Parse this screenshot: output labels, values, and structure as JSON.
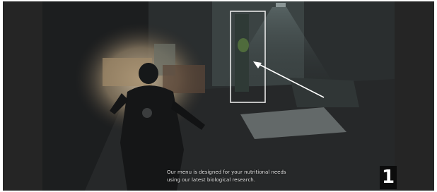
{
  "subtitle": {
    "line1": "Our menu is designed for your nutritional needs",
    "line2": "using our latest biological research."
  },
  "step_badge": "1",
  "annotation": {
    "highlight_color": "#e6e6e6",
    "arrow_color": "#ffffff",
    "target": "plant-in-vent"
  },
  "scene": {
    "light": "flashlight",
    "character": "player-character"
  }
}
